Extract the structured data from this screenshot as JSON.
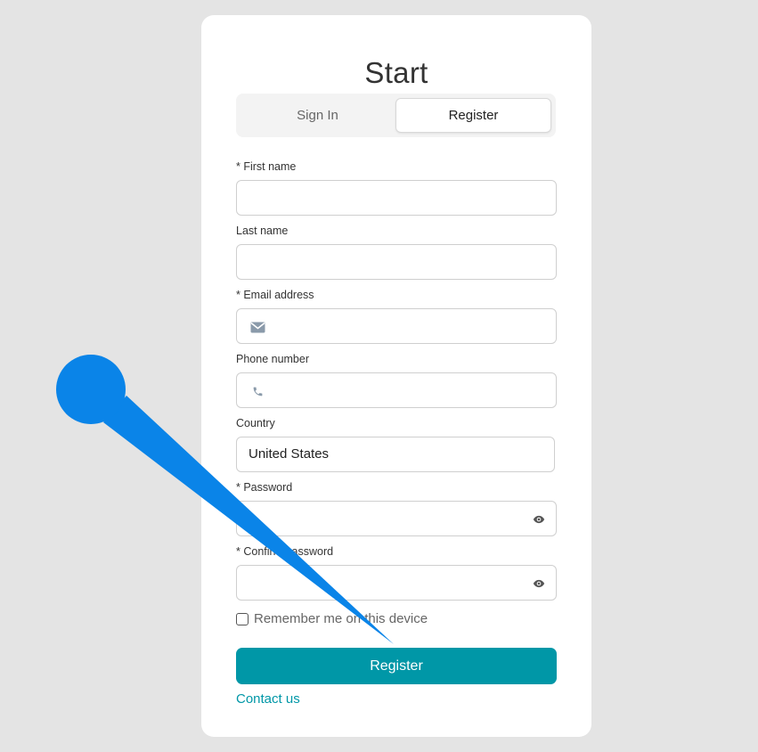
{
  "title": "Start",
  "tabs": [
    {
      "label": "Sign In",
      "active": false
    },
    {
      "label": "Register",
      "active": true
    }
  ],
  "fields": {
    "first_name": {
      "label": "* First name",
      "value": ""
    },
    "last_name": {
      "label": "Last name",
      "value": ""
    },
    "email": {
      "label": "* Email address",
      "value": "",
      "icon": "envelope-icon"
    },
    "phone": {
      "label": "Phone number",
      "value": "",
      "icon": "phone-icon"
    },
    "country": {
      "label": "Country",
      "value": "United States"
    },
    "password": {
      "label": "* Password",
      "value": "",
      "icon": "eye-icon"
    },
    "confirm_password": {
      "label": "* Confirm password",
      "value": "",
      "icon": "eye-icon"
    }
  },
  "remember": {
    "label": "Remember me on this device",
    "checked": false
  },
  "submit_label": "Register",
  "contact_label": "Contact us",
  "colors": {
    "accent": "#0097a7",
    "background": "#e4e4e4",
    "card": "#ffffff",
    "annotation": "#0a84e8"
  }
}
